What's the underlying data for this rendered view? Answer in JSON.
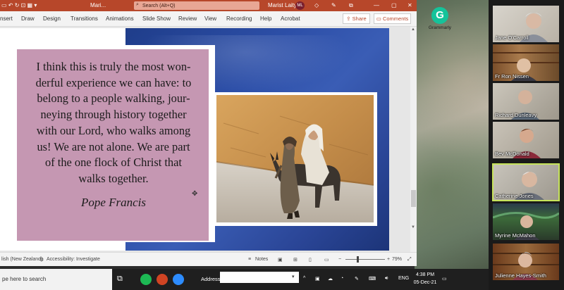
{
  "powerpoint": {
    "title_file": "Mari...",
    "search_placeholder": "Search (Alt+Q)",
    "user_name": "Marist Laity",
    "user_initials": "ML",
    "ribbon_tabs": [
      "nsert",
      "Draw",
      "Design",
      "Transitions",
      "Animations",
      "Slide Show",
      "Review",
      "View",
      "Recording",
      "Help",
      "Acrobat"
    ],
    "share_label": "Share",
    "comments_label": "Comments",
    "slide": {
      "quote": "I think this is truly the most wonderful experience we can have: to belong to a people walking, journeying through history together with our Lord, who walks among us! We are not alone. We are part of the one flock of Christ that walks together.",
      "quote_lines": [
        "I think this is truly the most won-",
        "derful experience we can have: to",
        "belong to a people walking, jour-",
        "neying through history together",
        "with our Lord, who walks among",
        "us! We are not alone. We are part",
        "of the one flock of Christ that",
        "walks together."
      ],
      "author": "Pope Francis",
      "photo_alt": "Mary riding a donkey led by Joseph"
    },
    "status": {
      "language": "lish (New Zealand)",
      "accessibility": "Accessibility: Investigate",
      "notes": "Notes",
      "zoom": "79%"
    }
  },
  "grammarly": {
    "label": "Grammarly"
  },
  "participants": [
    {
      "name": "Jane O'Carroll",
      "active": false
    },
    {
      "name": "Fr Ron Nissen",
      "active": false
    },
    {
      "name": "Richard Dunleavy",
      "active": false
    },
    {
      "name": "Bev McDonald",
      "active": false
    },
    {
      "name": "Catherine Jones",
      "active": true
    },
    {
      "name": "Myrine McMahon",
      "active": false
    },
    {
      "name": "Julienne Hayes-Smith",
      "active": false
    }
  ],
  "taskbar": {
    "search_placeholder": "pe here to search",
    "address_label": "Address",
    "language": "ENG",
    "time": "4:38 PM",
    "date": "05-Dec-21"
  },
  "colors": {
    "ppt_accent": "#b7472a",
    "quote_box": "#c597b2",
    "slide_blue": "#2d4fa8",
    "active_tile": "#c6e35a"
  }
}
